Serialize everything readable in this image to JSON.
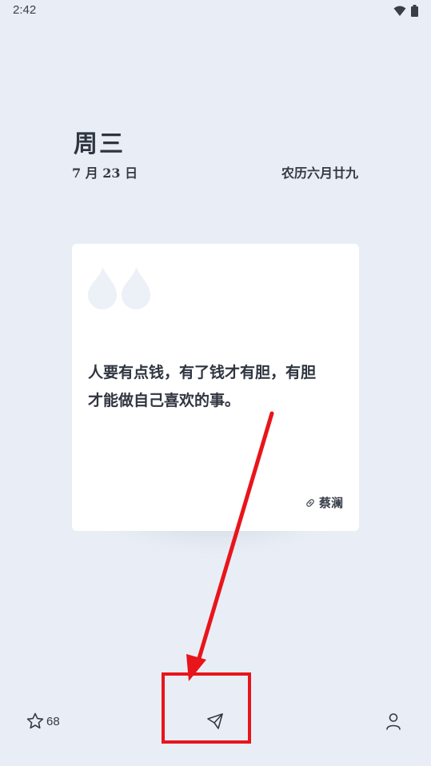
{
  "status_bar": {
    "time": "2:42",
    "wifi_icon": "wifi-icon",
    "battery_icon": "battery-icon"
  },
  "header": {
    "weekday": "周三",
    "date": "7 月 23 日",
    "lunar_date": "农历六月廿九"
  },
  "card": {
    "quote_icon": "quote-mark-icon",
    "quote_line_1": "人要有点钱，有了钱才有胆，有胆",
    "quote_line_2": "才能做自己喜欢的事。",
    "author_icon": "link-icon",
    "author": "蔡澜"
  },
  "bottom_bar": {
    "favorite_icon": "star-icon",
    "favorite_count": "68",
    "send_icon": "paper-plane-icon",
    "profile_icon": "user-icon"
  },
  "annotation": {
    "color": "#e8151b"
  },
  "colors": {
    "background": "#e9eef6",
    "card": "#ffffff",
    "text": "#2f3540",
    "quote_mark": "#e9eef6"
  }
}
